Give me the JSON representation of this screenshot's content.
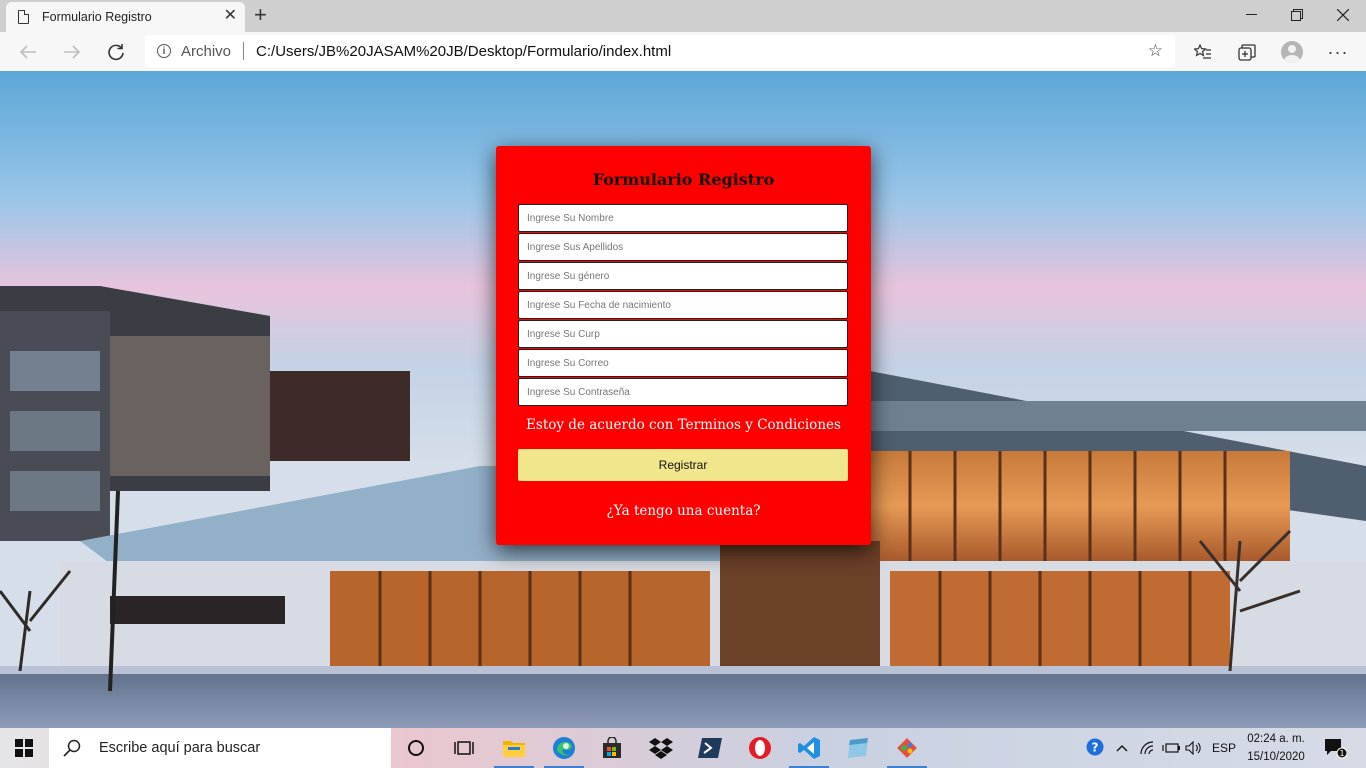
{
  "browser": {
    "tab_title": "Formulario Registro",
    "address_prefix": "Archivo",
    "url": "C:/Users/JB%20JASAM%20JB/Desktop/Formulario/index.html"
  },
  "form": {
    "title": "Formulario Registro",
    "placeholders": {
      "nombre": "Ingrese Su Nombre",
      "apellidos": "Ingrese Sus Apellidos",
      "genero": "Ingrese Su género",
      "fecha": "Ingrese Su Fecha de nacimiento",
      "curp": "Ingrese Su Curp",
      "correo": "Ingrese Su Correo",
      "contrasena": "Ingrese Su Contraseña"
    },
    "terms_prefix": "Estoy de acuerdo con ",
    "terms_link": "Terminos y Condiciones",
    "submit_label": "Registrar",
    "login_link": "¿Ya tengo una cuenta?",
    "colors": {
      "card": "#ff0000",
      "button": "#f0e68c"
    }
  },
  "taskbar": {
    "search_placeholder": "Escribe aquí para buscar",
    "language": "ESP",
    "time": "02:24 a. m.",
    "date": "15/10/2020",
    "notification_count": "1",
    "apps": [
      "task-view",
      "file-explorer",
      "edge",
      "store",
      "dropbox",
      "powershell",
      "opera",
      "vscode",
      "notepad",
      "git"
    ]
  }
}
